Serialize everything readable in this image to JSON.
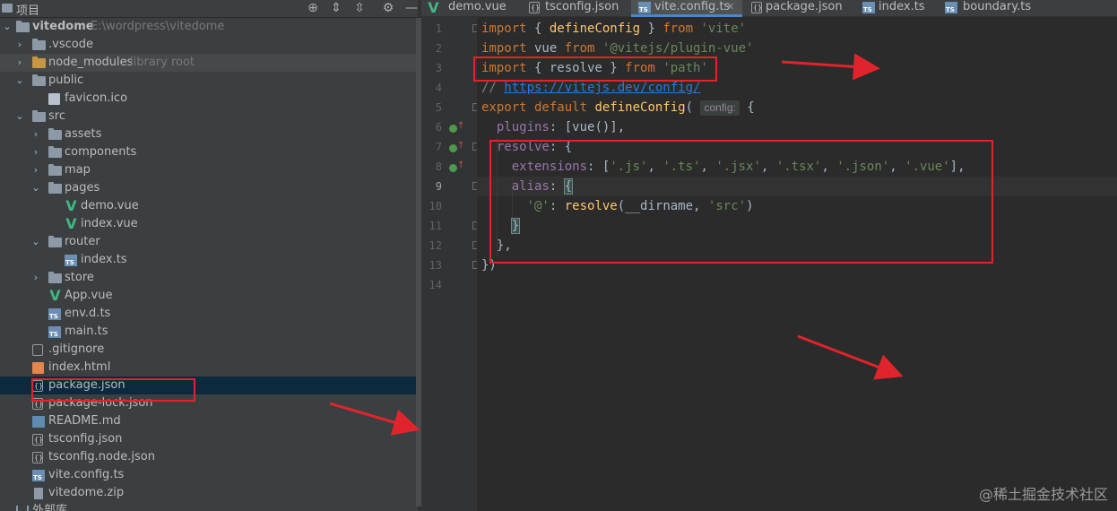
{
  "project_panel": {
    "title": "项目",
    "tree": [
      {
        "label": "vitedome",
        "path": "E:\\wordpress\\vitedome",
        "type": "folder-root"
      },
      {
        "label": ".vscode",
        "type": "folder"
      },
      {
        "label": "node_modules",
        "note": "library root",
        "type": "folder-orange"
      },
      {
        "label": "public",
        "type": "folder"
      },
      {
        "label": "favicon.ico",
        "type": "favicon"
      },
      {
        "label": "src",
        "type": "folder"
      },
      {
        "label": "assets",
        "type": "folder"
      },
      {
        "label": "components",
        "type": "folder"
      },
      {
        "label": "map",
        "type": "folder"
      },
      {
        "label": "pages",
        "type": "folder"
      },
      {
        "label": "demo.vue",
        "type": "vue"
      },
      {
        "label": "index.vue",
        "type": "vue"
      },
      {
        "label": "router",
        "type": "folder"
      },
      {
        "label": "index.ts",
        "type": "ts"
      },
      {
        "label": "store",
        "type": "folder"
      },
      {
        "label": "App.vue",
        "type": "vue"
      },
      {
        "label": "env.d.ts",
        "type": "ts"
      },
      {
        "label": "main.ts",
        "type": "ts"
      },
      {
        "label": ".gitignore",
        "type": "git"
      },
      {
        "label": "index.html",
        "type": "html"
      },
      {
        "label": "package.json",
        "type": "json"
      },
      {
        "label": "package-lock.json",
        "type": "json"
      },
      {
        "label": "README.md",
        "type": "md"
      },
      {
        "label": "tsconfig.json",
        "type": "json"
      },
      {
        "label": "tsconfig.node.json",
        "type": "json"
      },
      {
        "label": "vite.config.ts",
        "type": "ts"
      },
      {
        "label": "vitedome.zip",
        "type": "zip"
      },
      {
        "label": "外部库",
        "type": "lib"
      }
    ]
  },
  "tabs": [
    {
      "label": "demo.vue",
      "type": "vue"
    },
    {
      "label": "tsconfig.json",
      "type": "json"
    },
    {
      "label": "vite.config.ts",
      "type": "ts",
      "active": true
    },
    {
      "label": "package.json",
      "type": "json"
    },
    {
      "label": "index.ts",
      "type": "ts"
    },
    {
      "label": "boundary.ts",
      "type": "ts"
    }
  ],
  "editor": {
    "line_numbers": [
      "1",
      "2",
      "3",
      "4",
      "5",
      "6",
      "7",
      "8",
      "9",
      "10",
      "11",
      "12",
      "13",
      "14"
    ],
    "code": {
      "l1": {
        "kw1": "import",
        "p1": " { ",
        "fn": "defineConfig",
        "p2": " } ",
        "kw2": "from",
        "sp": " ",
        "str": "'vite'"
      },
      "l2": {
        "kw1": "import",
        "p1": " vue ",
        "kw2": "from",
        "sp": " ",
        "str": "'@vitejs/plugin-vue'"
      },
      "l3": {
        "kw1": "import",
        "p1": " { resolve } ",
        "kw2": "from",
        "sp": " ",
        "str": "'path'"
      },
      "l4": {
        "cm": "// ",
        "link": "https://vitejs.dev/config/"
      },
      "l5": {
        "kw1": "export default ",
        "fn": "defineConfig",
        "p1": "(",
        "hint": "config:",
        "p2": " {"
      },
      "l6": {
        "indent": "  ",
        "prop": "plugins",
        "p1": ": [vue()],"
      },
      "l7": {
        "indent": "  ",
        "prop": "resolve",
        "p1": ": {"
      },
      "l8": {
        "indent": "    ",
        "prop": "extensions",
        "p1": ": [",
        "s1": "'.js'",
        "s2": "'.ts'",
        "s3": "'.jsx'",
        "s4": "'.tsx'",
        "s5": "'.json'",
        "s6": "'.vue'",
        "sep": ", ",
        "p2": "],"
      },
      "l9": {
        "indent": "    ",
        "prop": "alias",
        "p1": ": ",
        "brace": "{"
      },
      "l10": {
        "indent": "      ",
        "str": "'@'",
        "p1": ": ",
        "fn": "resolve",
        "p2": "(__dirname, ",
        "str2": "'src'",
        "p3": ")"
      },
      "l11": {
        "indent": "    ",
        "brace": "}"
      },
      "l12": {
        "indent": "  ",
        "p1": "},"
      },
      "l13": {
        "p1": "})"
      }
    }
  },
  "watermark": "@稀土掘金技术社区",
  "colors": {
    "annotation_red": "#e0242b",
    "selection": "#0d293e",
    "active_tab_underline": "#4a88c7"
  }
}
